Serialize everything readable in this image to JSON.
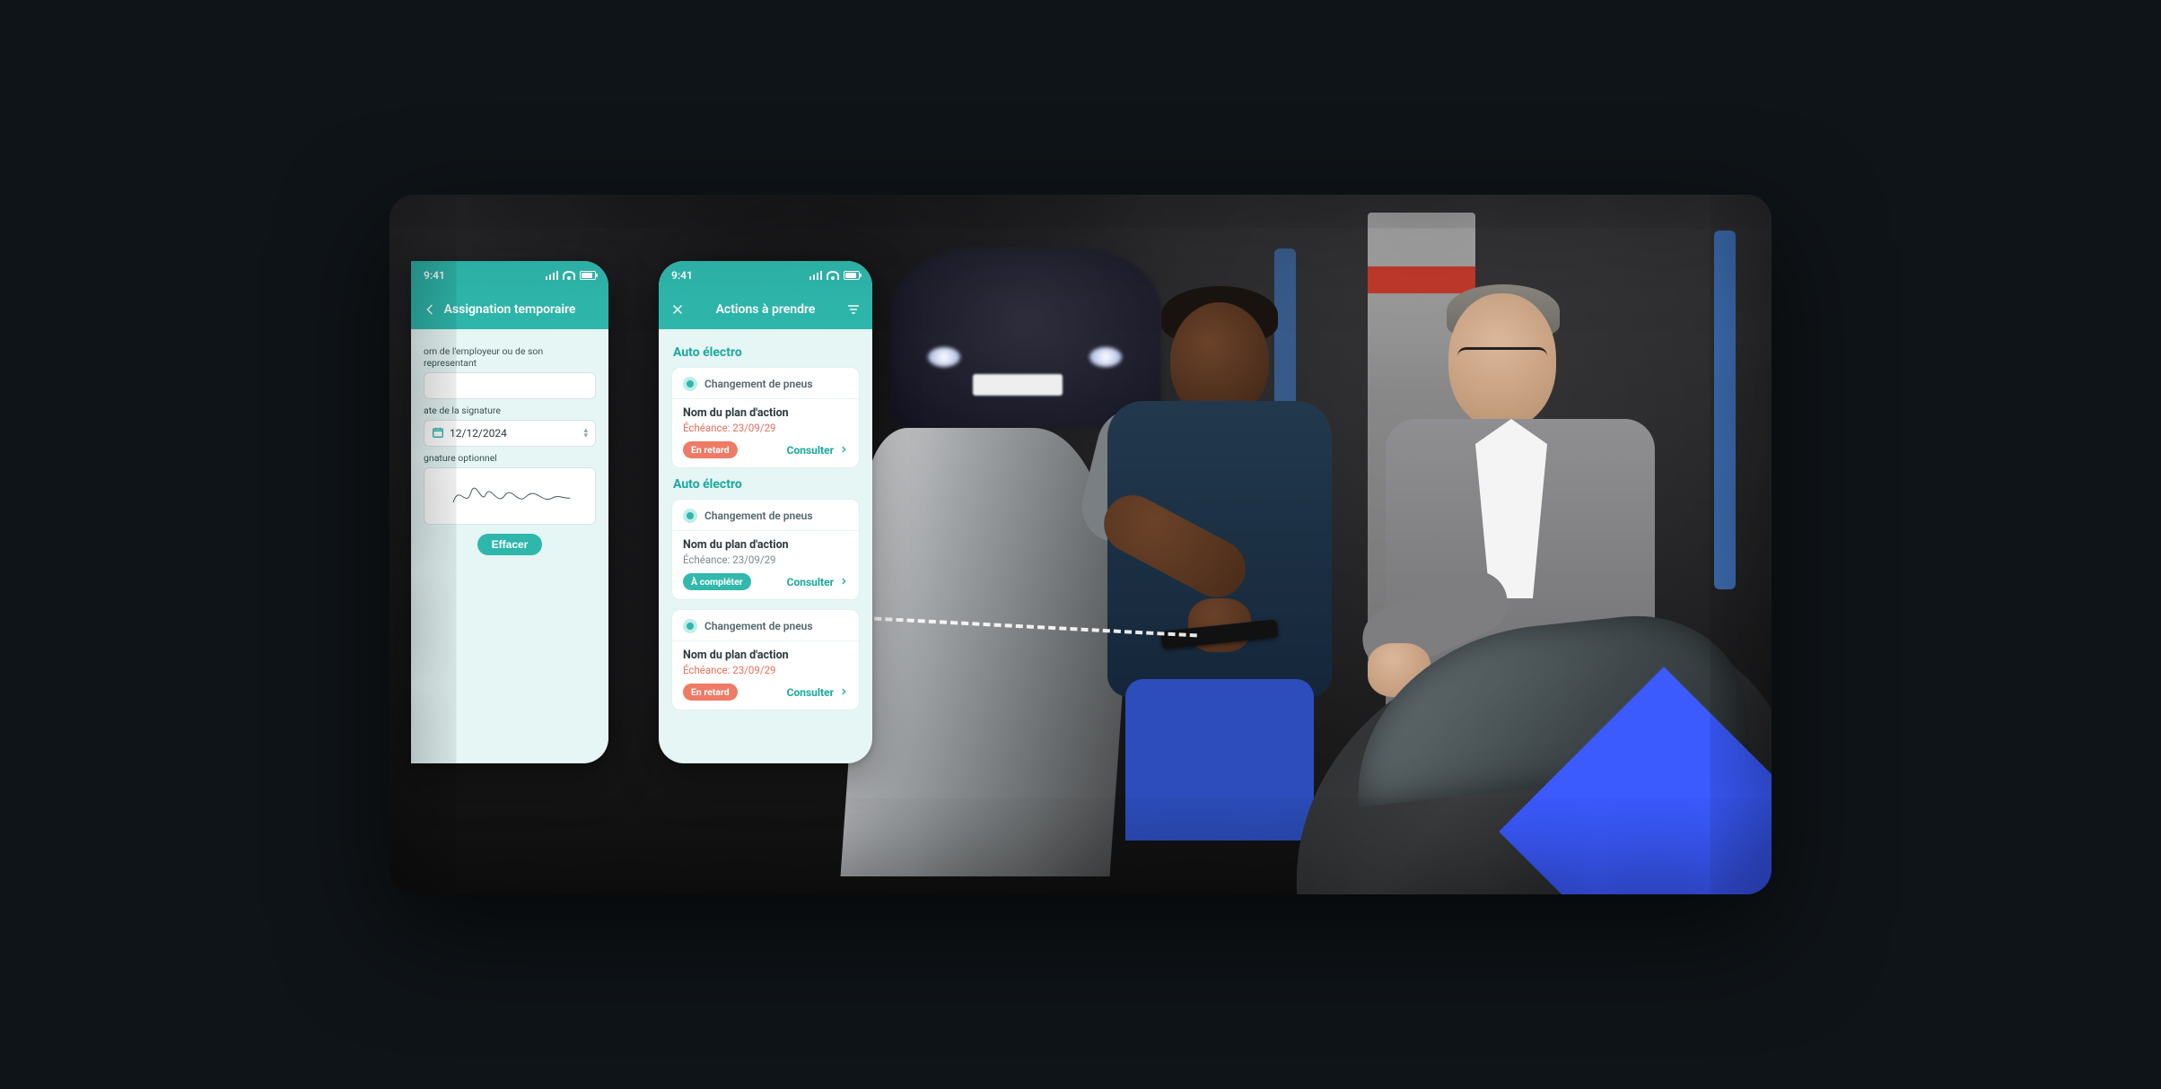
{
  "statusbar": {
    "time": "9:41"
  },
  "phone_left": {
    "appbar": {
      "title": "Assignation temporaire"
    },
    "form": {
      "employer_label": "om de l'employeur ou de son representant",
      "employer_value": "",
      "date_label": "ate de la signature",
      "date_value": "12/12/2024",
      "signature_label": "gnature optionnel",
      "clear_button": "Effacer"
    }
  },
  "phone_right": {
    "appbar": {
      "title": "Actions à prendre"
    },
    "sections": [
      {
        "title": "Auto électro",
        "cards": [
          {
            "task": "Changement de pneus",
            "plan": "Nom du plan d'action",
            "deadline_label": "Échéance: 23/09/29",
            "deadline_tone": "late",
            "badge": "En retard",
            "badge_tone": "late",
            "action": "Consulter"
          }
        ]
      },
      {
        "title": "Auto électro",
        "cards": [
          {
            "task": "Changement de pneus",
            "plan": "Nom du plan d'action",
            "deadline_label": "Échéance: 23/09/29",
            "deadline_tone": "normal",
            "badge": "À compléter",
            "badge_tone": "todo",
            "action": "Consulter"
          },
          {
            "task": "Changement de pneus",
            "plan": "Nom du plan d'action",
            "deadline_label": "Échéance: 23/09/29",
            "deadline_tone": "late",
            "badge": "En retard",
            "badge_tone": "late",
            "action": "Consulter"
          }
        ]
      }
    ]
  },
  "colors": {
    "brand": "#2fb7ac",
    "brand_dark": "#18a99d",
    "late": "#ef7a66",
    "accent_corner": "#3b5bff"
  }
}
